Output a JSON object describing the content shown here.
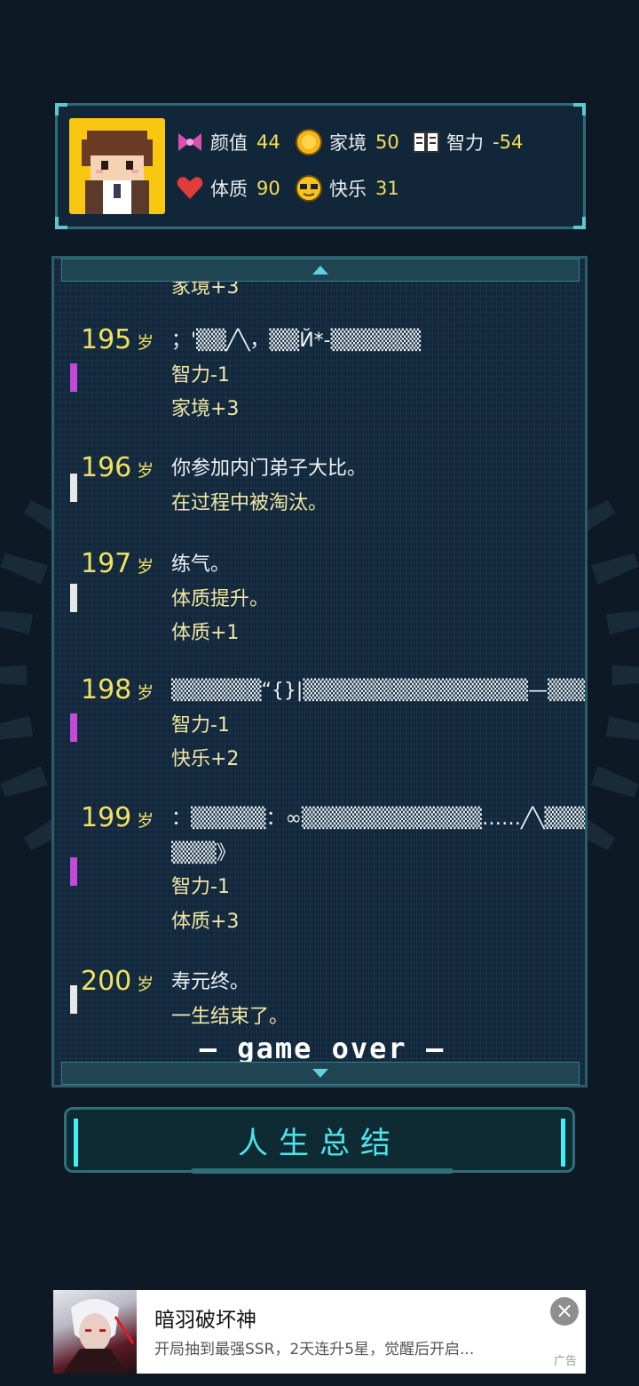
{
  "stats": [
    {
      "icon": "bow-icon",
      "label": "颜值",
      "value": "44"
    },
    {
      "icon": "coin-icon",
      "label": "家境",
      "value": "50"
    },
    {
      "icon": "book-icon",
      "label": "智力",
      "value": "-54"
    },
    {
      "icon": "heart-icon",
      "label": "体质",
      "value": "90"
    },
    {
      "icon": "sunglasses-icon",
      "label": "快乐",
      "value": "31"
    }
  ],
  "log": {
    "partial_top_line": "家境+3",
    "year_suffix": "岁",
    "entries": [
      {
        "age": "195",
        "marker": "purple",
        "lines": [
          "；'▒▒╱╲，▒▒Й*-▒▒▒▒▒▒",
          "智力-1",
          "家境+3"
        ]
      },
      {
        "age": "196",
        "marker": "white",
        "lines": [
          "你参加内门弟子大比。",
          "在过程中被淘汰。"
        ]
      },
      {
        "age": "197",
        "marker": "white",
        "lines": [
          "练气。",
          "体质提升。",
          "体质+1"
        ]
      },
      {
        "age": "198",
        "marker": "purple",
        "lines": [
          "▒▒▒▒▒▒“{}|▒▒▒▒▒▒▒▒▒▒▒▒▒▒▒—▒▒▒▒▒▒▒▒&",
          "智力-1",
          "快乐+2"
        ]
      },
      {
        "age": "199",
        "marker": "purple",
        "lines": [
          "：▒▒▒▒▒：∞▒▒▒▒▒▒▒▒▒▒▒▒……╱╲▒▒▒▒",
          "▒▒▒》",
          "智力-1",
          "体质+3"
        ]
      },
      {
        "age": "200",
        "marker": "white",
        "lines": [
          "寿元终。",
          "一生结束了。"
        ]
      }
    ],
    "game_over": "— game over —"
  },
  "summary_button": "人生总结",
  "ad": {
    "title": "暗羽破坏神",
    "description": "开局抽到最强SSR，2天连升5星，觉醒后开启...",
    "tag": "广告"
  },
  "colors": {
    "accent": "#4fe3e8",
    "number": "#f1e260",
    "marker_purple": "#c24ad8",
    "marker_white": "#e8e8e8"
  }
}
